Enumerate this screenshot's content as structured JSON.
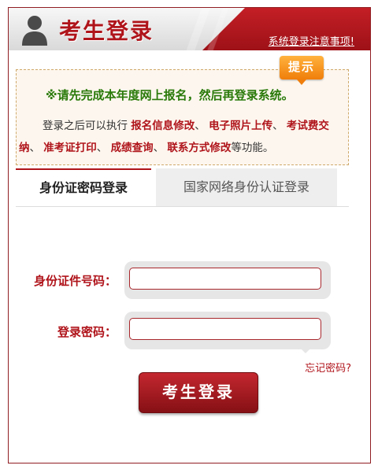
{
  "header": {
    "title": "考生登录",
    "notice_link": "系统登录注意事项!"
  },
  "tip": {
    "badge": "提示",
    "headline": "※请先完成本年度网上报名，然后再登录系统。",
    "intro": "登录之后可以执行",
    "features": [
      "报名信息修改",
      "电子照片上传",
      "考试费交纳",
      "准考证打印",
      "成绩查询",
      "联系方式修改"
    ],
    "suffix": "等功能。"
  },
  "tabs": [
    {
      "label": "身份证密码登录",
      "active": true
    },
    {
      "label": "国家网络身份认证登录",
      "active": false
    }
  ],
  "form": {
    "id_label": "身份证件号码：",
    "id_value": "",
    "password_label": "登录密码：",
    "password_value": "",
    "forgot_label": "忘记密码?",
    "submit_label": "考生登录"
  },
  "colors": {
    "brand_red": "#b0141b",
    "tip_green": "#2a7a0a",
    "tip_orange": "#f07e0a"
  }
}
